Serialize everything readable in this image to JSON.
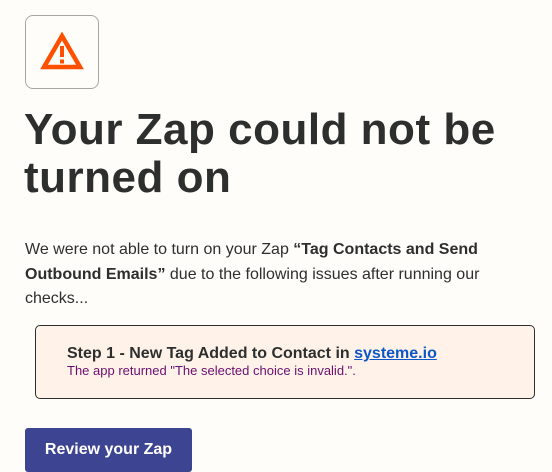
{
  "icon": {
    "name": "warning-triangle-icon",
    "color": "#ff4f00"
  },
  "title": "Your Zap could not be turned on",
  "intro": {
    "prefix": "We were not able to turn on your Zap ",
    "zap_name": "“Tag Contacts and Send Outbound Emails”",
    "suffix": " due to the following issues after running our checks..."
  },
  "error": {
    "step_label": "Step 1 - New Tag Added to Contact in ",
    "app_link": "systeme.io",
    "message": "The app returned \"The selected choice is invalid.\"."
  },
  "button": {
    "label": "Review your Zap"
  },
  "colors": {
    "background": "#fffdf9",
    "card_background": "#fff3e9",
    "button": "#3d4593",
    "link": "#0c56c8",
    "error_text": "#6b0e6e"
  }
}
